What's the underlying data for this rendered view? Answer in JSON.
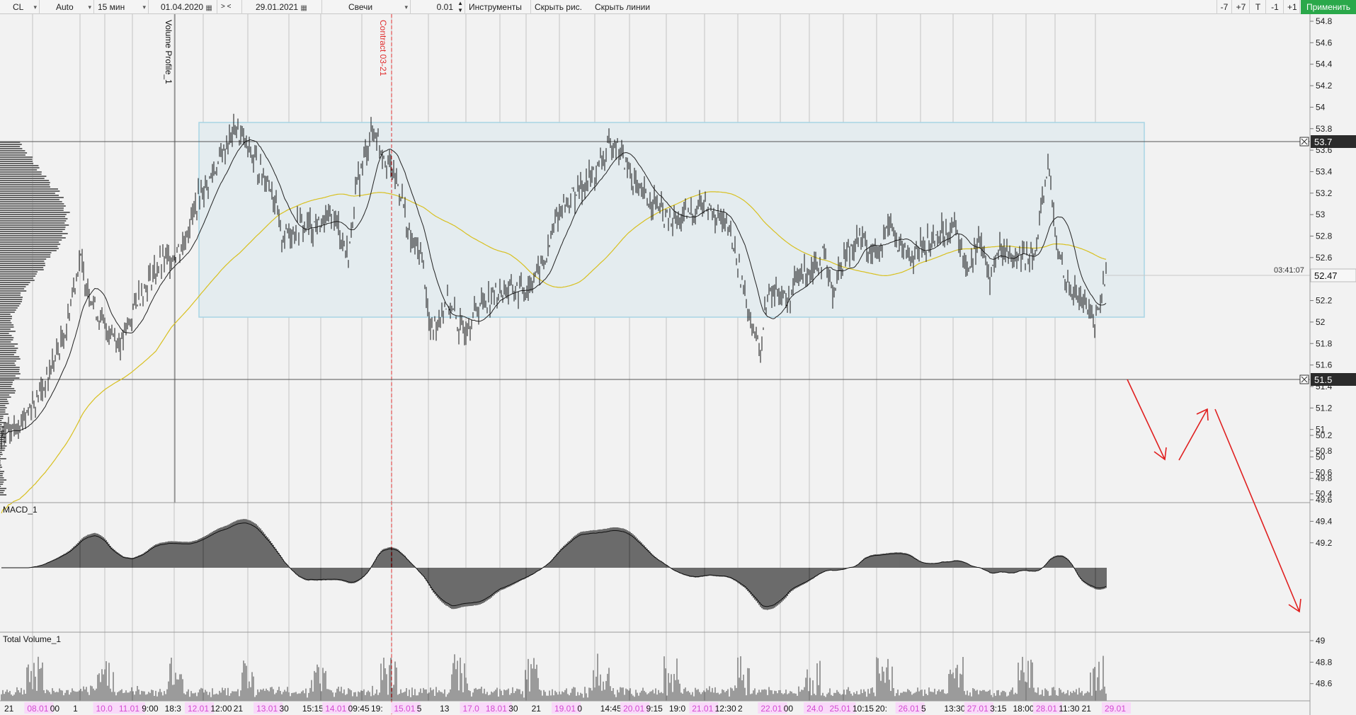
{
  "toolbar": {
    "symbol": "CL",
    "scale": "Auto",
    "timeframe": "15 мин",
    "date_from": "01.04.2020",
    "nav_next": ">",
    "nav_prev": "<",
    "date_to": "29.01.2021",
    "chart_type": "Свечи",
    "step": "0.01",
    "instruments": "Инструменты",
    "hide_drawings": "Скрыть рис.",
    "hide_lines": "Скрыть линии",
    "minus7": "-7",
    "plus7": "+7",
    "t_btn": "T",
    "minus1": "-1",
    "plus1": "+1",
    "apply": "Применить"
  },
  "panes": {
    "main_annotations": {
      "volume_profile": "Volume Profile_1",
      "contract": "Contract 03-21"
    },
    "macd_label": "MACD_1",
    "volume_label": "Total Volume_1"
  },
  "price_axis": {
    "ticks": [
      "54.8",
      "54.6",
      "54.4",
      "54.2",
      "54",
      "53.8",
      "53.6",
      "53.4",
      "53.2",
      "53",
      "52.8",
      "52.6",
      "52.4",
      "52.2",
      "52",
      "51.8",
      "51.6",
      "51.4",
      "51.2",
      "51",
      "50.8",
      "50.6",
      "50.4",
      "50.2",
      "50",
      "49.8",
      "49.6",
      "49.4",
      "49.2",
      "49",
      "48.8",
      "48.6"
    ],
    "hline_high": "53.7",
    "hline_low": "51.5",
    "current_price": "52.47",
    "countdown": "03:41:07"
  },
  "time_axis": {
    "labels": [
      {
        "t": "21",
        "hl": false
      },
      {
        "t": "08.01",
        "hl": true
      },
      {
        "t": "00",
        "hl": false
      },
      {
        "t": "1",
        "hl": false
      },
      {
        "t": "10.0",
        "hl": true
      },
      {
        "t": "11.01",
        "hl": true
      },
      {
        "t": "9:00",
        "hl": false
      },
      {
        "t": "18:3",
        "hl": false
      },
      {
        "t": "12.01",
        "hl": true
      },
      {
        "t": "12:00",
        "hl": false
      },
      {
        "t": "21",
        "hl": false
      },
      {
        "t": "13.01",
        "hl": true
      },
      {
        "t": "30",
        "hl": false
      },
      {
        "t": "15:15",
        "hl": false
      },
      {
        "t": "14.01",
        "hl": true
      },
      {
        "t": "09:45",
        "hl": false
      },
      {
        "t": "19:",
        "hl": false
      },
      {
        "t": "15.01",
        "hl": true
      },
      {
        "t": "5",
        "hl": false
      },
      {
        "t": "13",
        "hl": false
      },
      {
        "t": "17.0",
        "hl": true
      },
      {
        "t": "18.01",
        "hl": true
      },
      {
        "t": "30",
        "hl": false
      },
      {
        "t": "21",
        "hl": false
      },
      {
        "t": "19.01",
        "hl": true
      },
      {
        "t": "0",
        "hl": false
      },
      {
        "t": "14:45",
        "hl": false
      },
      {
        "t": "20.01",
        "hl": true
      },
      {
        "t": "9:15",
        "hl": false
      },
      {
        "t": "19:0",
        "hl": false
      },
      {
        "t": "21.01",
        "hl": true
      },
      {
        "t": "12:30",
        "hl": false
      },
      {
        "t": "2",
        "hl": false
      },
      {
        "t": "22.01",
        "hl": true
      },
      {
        "t": "00",
        "hl": false
      },
      {
        "t": "24.0",
        "hl": true
      },
      {
        "t": "25.01",
        "hl": true
      },
      {
        "t": "10:15",
        "hl": false
      },
      {
        "t": "20:",
        "hl": false
      },
      {
        "t": "26.01",
        "hl": true
      },
      {
        "t": "5",
        "hl": false
      },
      {
        "t": "13:30",
        "hl": false
      },
      {
        "t": "27.01",
        "hl": true
      },
      {
        "t": "3:15",
        "hl": false
      },
      {
        "t": "18:00",
        "hl": false
      },
      {
        "t": "28.01",
        "hl": true
      },
      {
        "t": "11:30",
        "hl": false
      },
      {
        "t": "21",
        "hl": false
      },
      {
        "t": "29.01",
        "hl": true
      }
    ]
  },
  "colors": {
    "background": "#f2f2f2",
    "candles": "#111111",
    "range_box": "#e4ecef",
    "range_box_border": "#a8d4e4",
    "ma_yellow": "#d8c020",
    "contract_line": "#e03030",
    "forecast_arrows": "#e02020",
    "apply_button": "#2aa84a",
    "date_highlight": "#d24bd2"
  }
}
